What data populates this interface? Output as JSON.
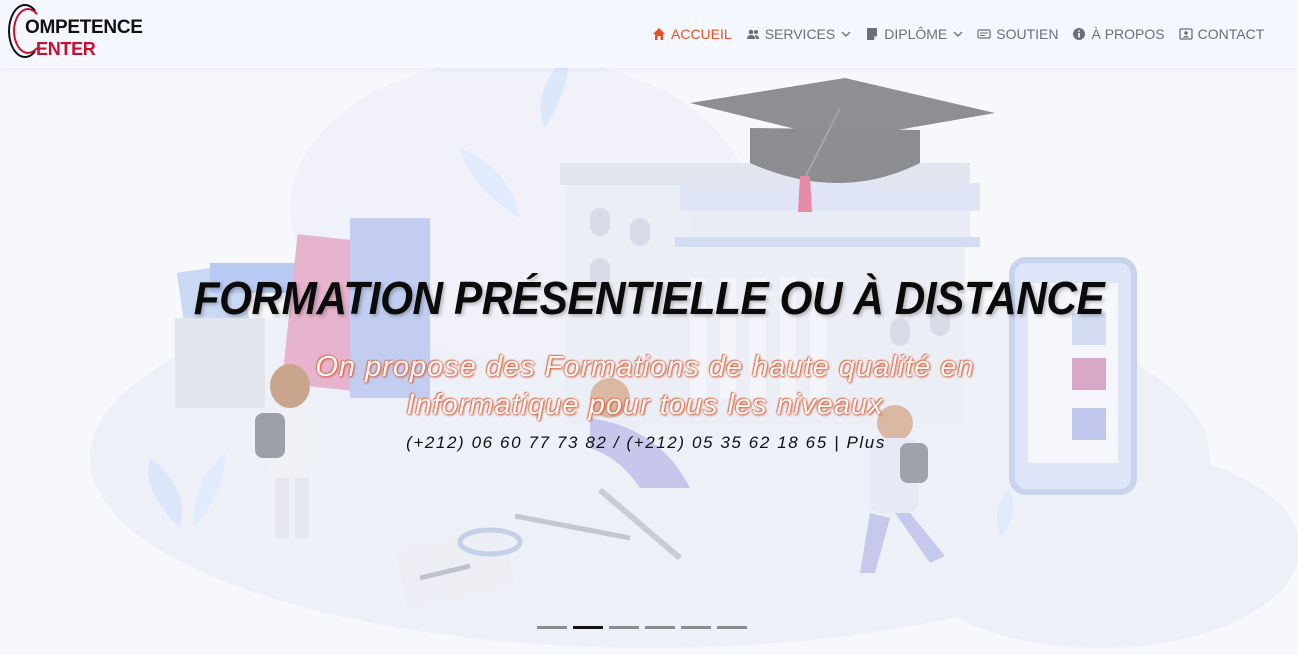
{
  "logo": {
    "line1": "OMPETENCE",
    "line2": "ENTER"
  },
  "nav": {
    "items": [
      {
        "label": "ACCUEIL",
        "icon": "home-icon",
        "active": true
      },
      {
        "label": "SERVICES",
        "icon": "users-icon",
        "dropdown": true
      },
      {
        "label": "DIPLÔME",
        "icon": "document-icon",
        "dropdown": true
      },
      {
        "label": "SOUTIEN",
        "icon": "card-icon"
      },
      {
        "label": "À PROPOS",
        "icon": "info-icon"
      },
      {
        "label": "CONTACT",
        "icon": "contact-icon"
      }
    ]
  },
  "hero": {
    "title": "FORMATION PRÉSENTIELLE OU À DISTANCE",
    "subtitle_line1": "On propose des Formations de haute qualité en",
    "subtitle_line2": "Informatique pour tous les niveaux",
    "contact": "(+212) 06 60 77 73 82 / (+212) 05 35 62 18 65 | Plus"
  },
  "carousel": {
    "slide_count": 6,
    "active_index": 1
  },
  "colors": {
    "accent": "#e8501f",
    "nav_text": "#6b7078",
    "brand_red": "#c8102e"
  }
}
